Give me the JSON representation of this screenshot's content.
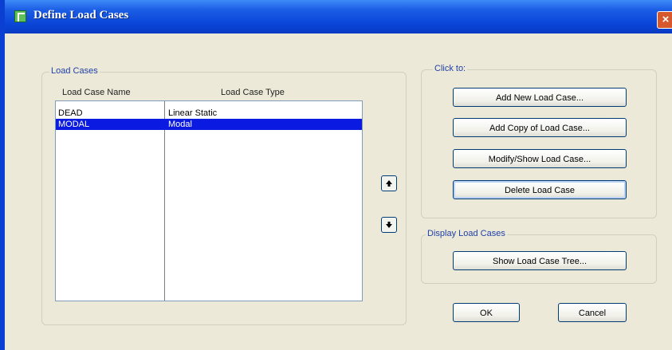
{
  "window": {
    "title": "Define Load Cases",
    "close_label": "×"
  },
  "load_cases": {
    "group_label": "Load Cases",
    "columns": {
      "name": "Load Case Name",
      "type": "Load Case Type"
    },
    "rows": [
      {
        "name": "DEAD",
        "type": "Linear Static",
        "selected": false
      },
      {
        "name": "MODAL",
        "type": "Modal",
        "selected": true
      }
    ]
  },
  "reorder": {
    "up_icon": "arrow-up-icon",
    "down_icon": "arrow-down-icon"
  },
  "click_to": {
    "group_label": "Click to:",
    "buttons": {
      "add_new": "Add New Load Case...",
      "add_copy": "Add Copy of Load Case...",
      "modify_show": "Modify/Show Load Case...",
      "delete": "Delete Load Case"
    }
  },
  "display": {
    "group_label": "Display Load Cases",
    "show_tree": "Show Load Case Tree..."
  },
  "footer": {
    "ok": "OK",
    "cancel": "Cancel"
  },
  "colors": {
    "selection": "#0b1ae0",
    "titlebar": "#0a46d8",
    "dialog_bg": "#ece9d8"
  }
}
